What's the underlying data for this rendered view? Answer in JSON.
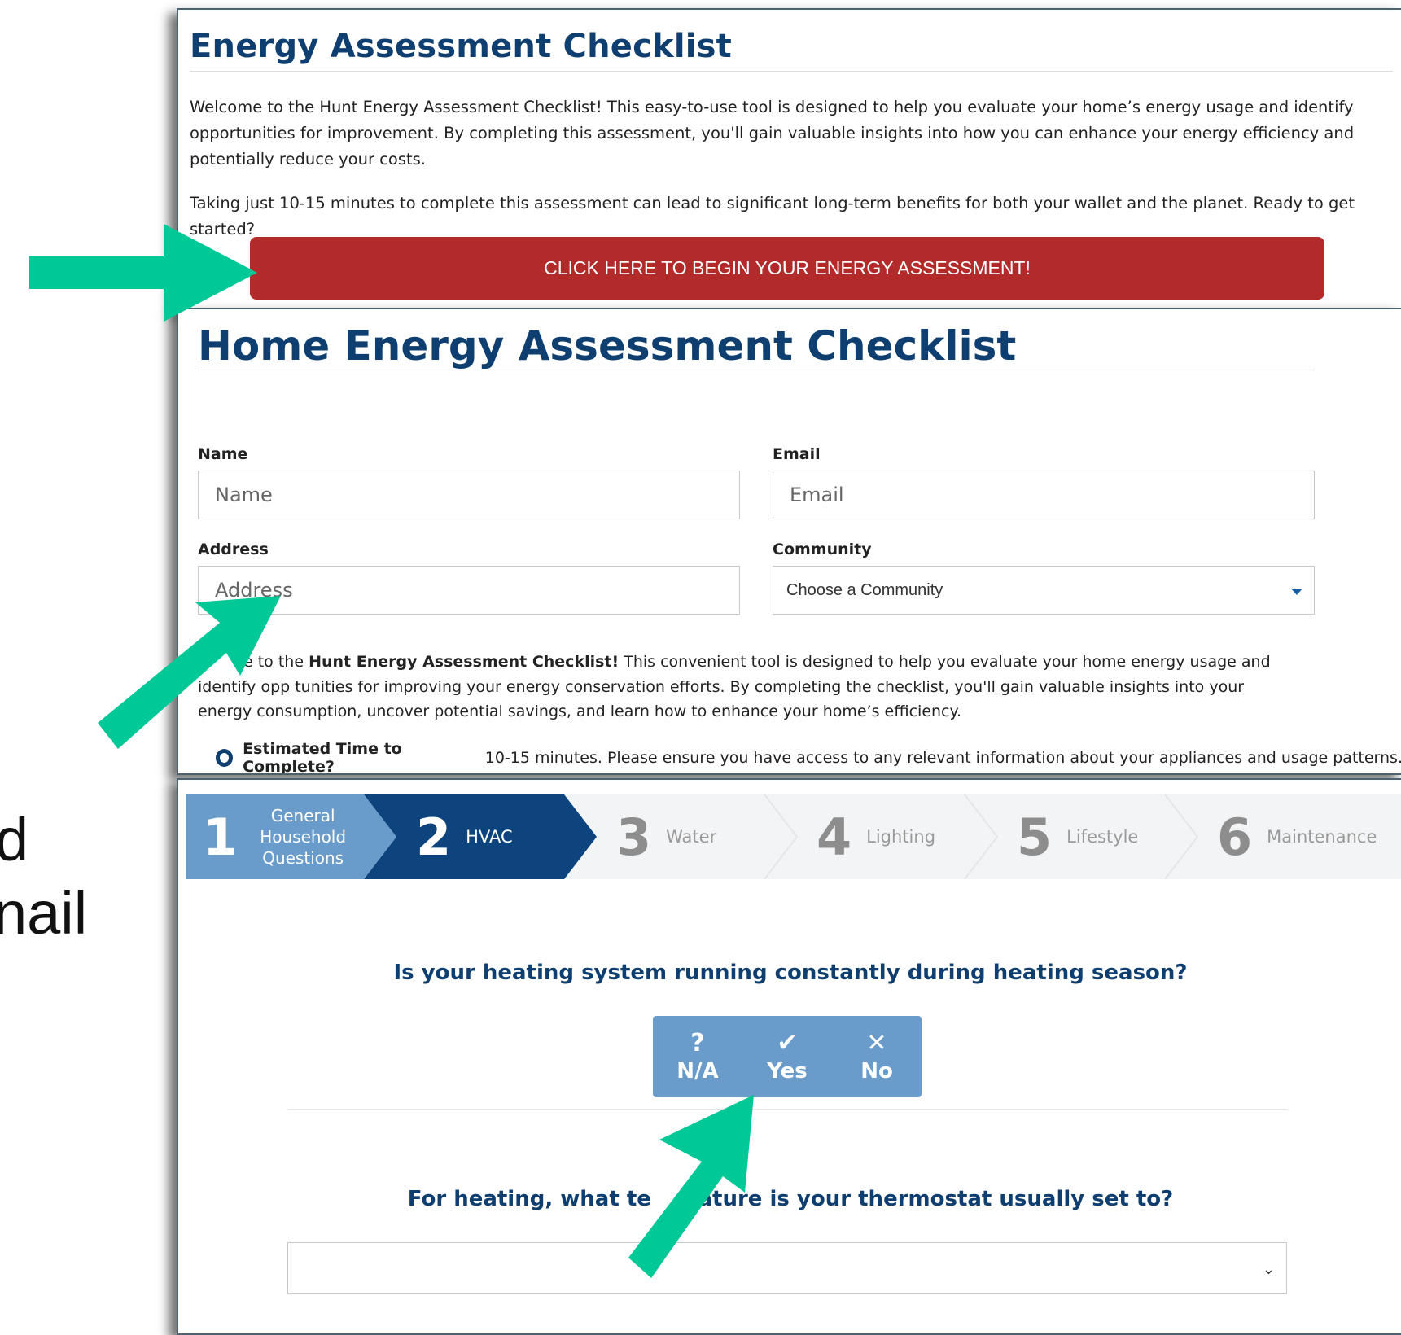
{
  "side_text": [
    "d",
    "nail"
  ],
  "panel1": {
    "title": "Energy Assessment Checklist",
    "intro": "Welcome to the Hunt Energy Assessment Checklist! This easy-to-use tool is designed to help you evaluate your home’s energy usage and identify opportunities for improvement. By completing this assessment, you'll gain valuable insights into how you can enhance your energy efficiency and potentially reduce your costs.",
    "time_text": "Taking just 10-15 minutes to complete this assessment can lead to significant long-term benefits for both your wallet and the planet. Ready to get started?",
    "begin_button": "CLICK HERE TO BEGIN YOUR ENERGY ASSESSMENT!"
  },
  "panel2": {
    "title": "Home Energy Assessment Checklist",
    "name_label": "Name",
    "name_placeholder": "Name",
    "email_label": "Email",
    "email_placeholder": "Email",
    "address_label": "Address",
    "address_placeholder": "Address",
    "community_label": "Community",
    "community_selected": "Choose a Community",
    "welcome_pre": "e to the ",
    "welcome_bold": "Hunt Energy Assessment Checklist!",
    "welcome_post": " This convenient tool is designed to help you evaluate your home energy usage and identify opp  tunities for improving your energy conservation efforts. By completing the checklist, you'll gain valuable insights into your energy consumption, uncover potential savings, and learn how to enhance your home’s efficiency.",
    "time_bold": "Estimated Time to Complete?",
    "time_text": " 10-15 minutes. Please ensure you have access to any relevant information about your appliances and usage patterns."
  },
  "steps": [
    {
      "number": "1",
      "label": "General Household Questions",
      "state": "completed"
    },
    {
      "number": "2",
      "label": "HVAC",
      "state": "active"
    },
    {
      "number": "3",
      "label": "Water",
      "state": "upcoming"
    },
    {
      "number": "4",
      "label": "Lighting",
      "state": "upcoming"
    },
    {
      "number": "5",
      "label": "Lifestyle",
      "state": "upcoming"
    },
    {
      "number": "6",
      "label": "Maintenance",
      "state": "upcoming"
    }
  ],
  "question1": "Is your heating system running constantly during heating season?",
  "choices": [
    {
      "icon": "question-icon",
      "glyph": "?",
      "label": "N/A"
    },
    {
      "icon": "check-icon",
      "glyph": "✔",
      "label": "Yes"
    },
    {
      "icon": "x-icon",
      "glyph": "✕",
      "label": "No"
    }
  ],
  "question2": "For heating, what te   erature is your thermostat usually set to?",
  "colors": {
    "title_blue": "#0e3f70",
    "button_red": "#b22a29",
    "step_completed": "#6a9ccb",
    "step_active": "#0e447e",
    "arrow_green": "#00c896"
  }
}
